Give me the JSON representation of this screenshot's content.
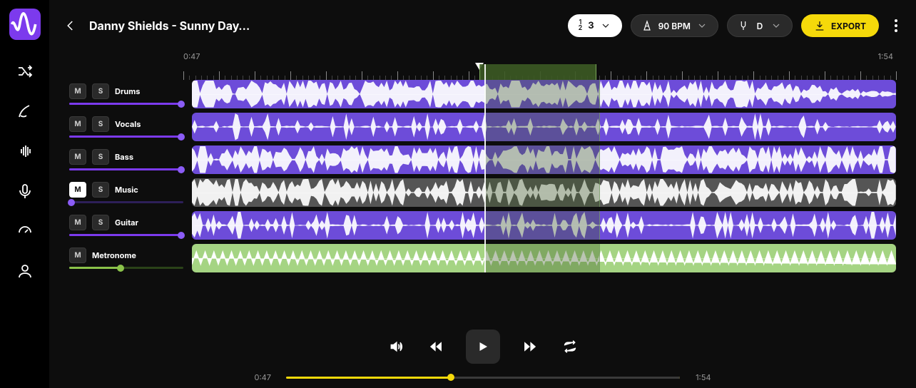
{
  "header": {
    "title": "Danny Shields - Sunny Day…",
    "count_label": "3",
    "bpm_label": "90 BPM",
    "key_label": "D",
    "export_label": "EXPORT"
  },
  "timeline": {
    "start": "0:47",
    "end": "1:54",
    "playhead_pct": 41.5,
    "loop": {
      "start_pct": 41.5,
      "end_pct": 58
    }
  },
  "tracks": [
    {
      "name": "Drums",
      "m": false,
      "s": false,
      "type": "active",
      "vol": 0.98,
      "wave": "dense",
      "density": 0.9,
      "tail": 0.78
    },
    {
      "name": "Vocals",
      "m": false,
      "s": false,
      "type": "active",
      "vol": 0.98,
      "wave": "sparse",
      "density": 0.35,
      "tail": 1.0
    },
    {
      "name": "Bass",
      "m": false,
      "s": false,
      "type": "active",
      "vol": 0.98,
      "wave": "dense",
      "density": 0.8,
      "tail": 1.0
    },
    {
      "name": "Music",
      "m": true,
      "s": false,
      "type": "muted",
      "vol": 0.02,
      "wave": "dense",
      "density": 0.7,
      "tail": 1.0
    },
    {
      "name": "Guitar",
      "m": false,
      "s": false,
      "type": "active",
      "vol": 0.98,
      "wave": "sparse",
      "density": 0.45,
      "tail": 1.0
    },
    {
      "name": "Metronome",
      "m": false,
      "s": null,
      "type": "green",
      "vol": 0.45,
      "wave": "zigzag",
      "density": 1.0,
      "tail": 1.0
    }
  ],
  "transport": {
    "current": "0:47",
    "total": "1:54",
    "progress_pct": 42
  }
}
